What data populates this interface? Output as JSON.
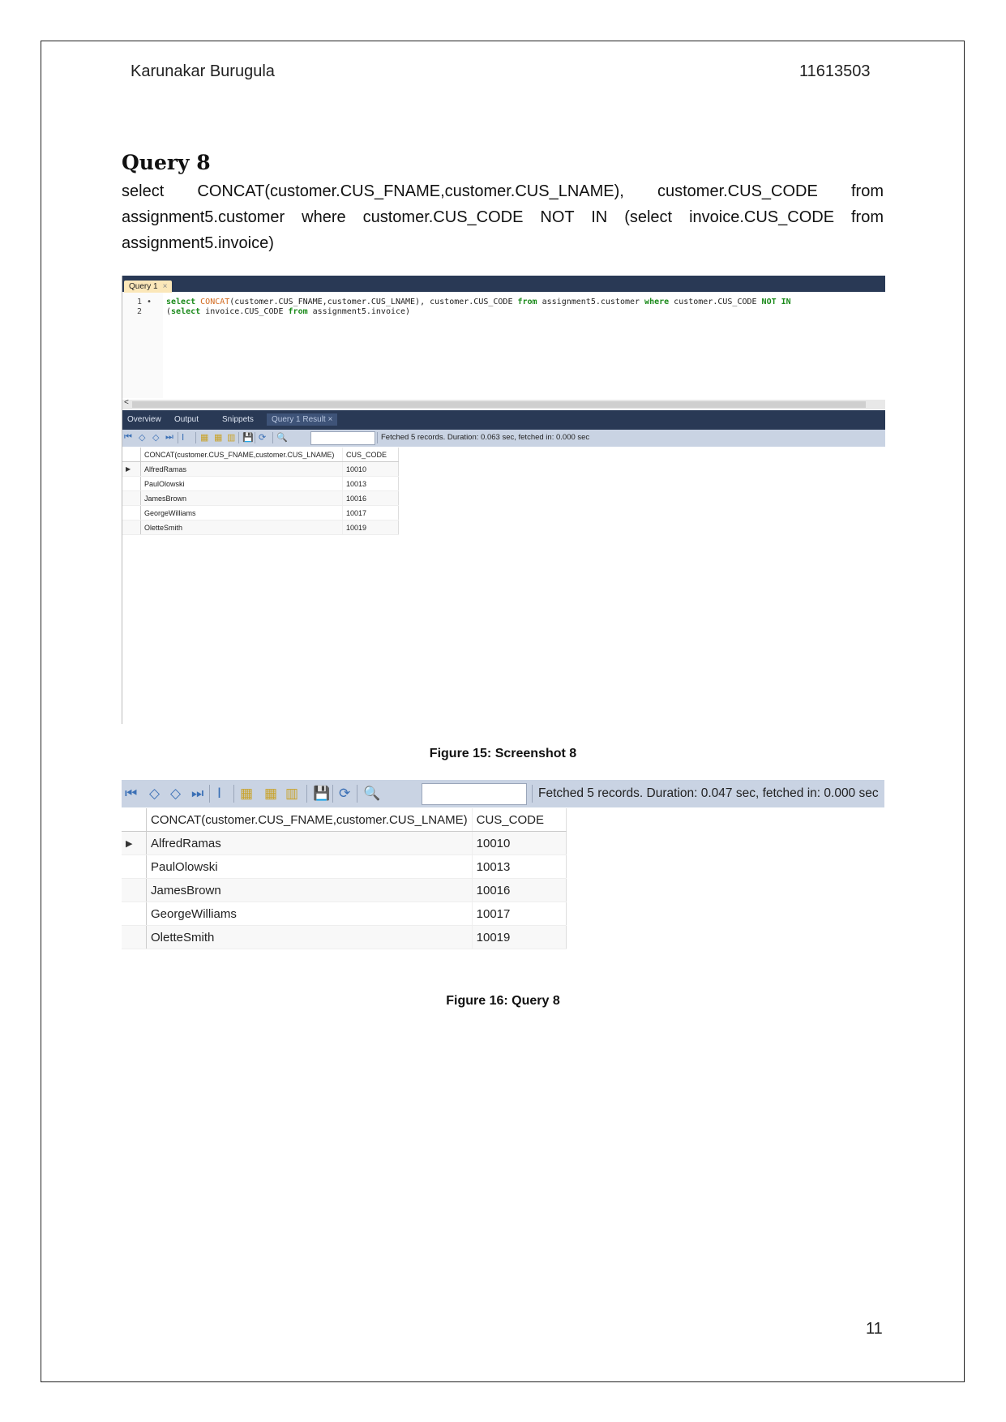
{
  "header": {
    "author": "Karunakar Burugula",
    "student_id": "11613503"
  },
  "section": {
    "title": "Query 8",
    "query_text": "select CONCAT(customer.CUS_FNAME,customer.CUS_LNAME), customer.CUS_CODE from assignment5.customer where customer.CUS_CODE NOT IN (select invoice.CUS_CODE from assignment5.invoice)"
  },
  "figure15": {
    "editor_tab": {
      "label": "Query 1",
      "close": "×"
    },
    "code_lines": [
      {
        "num": "1",
        "marker": "•",
        "parts": [
          {
            "t": "select ",
            "c": "kw"
          },
          {
            "t": "CONCAT",
            "c": "fn"
          },
          {
            "t": "(customer.CUS_FNAME,customer.CUS_LNAME), customer.CUS_CODE ",
            "c": ""
          },
          {
            "t": "from",
            "c": "kw"
          },
          {
            "t": " assignment5.customer ",
            "c": ""
          },
          {
            "t": "where",
            "c": "kw"
          },
          {
            "t": " customer.CUS_CODE ",
            "c": ""
          },
          {
            "t": "NOT IN",
            "c": "kw"
          }
        ]
      },
      {
        "num": "2",
        "marker": "",
        "parts": [
          {
            "t": "(",
            "c": ""
          },
          {
            "t": "select",
            "c": "kw"
          },
          {
            "t": " invoice.CUS_CODE ",
            "c": ""
          },
          {
            "t": "from",
            "c": "kw"
          },
          {
            "t": " assignment5.invoice)",
            "c": ""
          }
        ]
      }
    ],
    "scroll_arrow": "<",
    "result_tabs": [
      "Overview",
      "Output",
      "Snippets",
      "Query 1 Result"
    ],
    "result_tab_close": "×",
    "status": "Fetched 5 records. Duration: 0.063 sec, fetched in: 0.000 sec",
    "caption": "Figure 15: Screenshot 8"
  },
  "figure16": {
    "status": "Fetched 5 records. Duration: 0.047 sec, fetched in: 0.000 sec",
    "caption": "Figure 16: Query 8"
  },
  "toolbar_icons": [
    "first-record-icon",
    "prev-record-icon",
    "next-record-icon",
    "last-record-icon",
    "wrap-text-icon",
    "sort-asc-icon",
    "sort-desc-icon",
    "columns-icon",
    "export-icon",
    "refresh-icon",
    "search-icon"
  ],
  "result_grid": {
    "columns": [
      "CONCAT(customer.CUS_FNAME,customer.CUS_LNAME)",
      "CUS_CODE"
    ],
    "current_row_marker": "▶",
    "rows": [
      [
        "AlfredRamas",
        "10010"
      ],
      [
        "PaulOlowski",
        "10013"
      ],
      [
        "JamesBrown",
        "10016"
      ],
      [
        "GeorgeWilliams",
        "10017"
      ],
      [
        "OletteSmith",
        "10019"
      ]
    ]
  },
  "footer": {
    "page_number": "11"
  }
}
